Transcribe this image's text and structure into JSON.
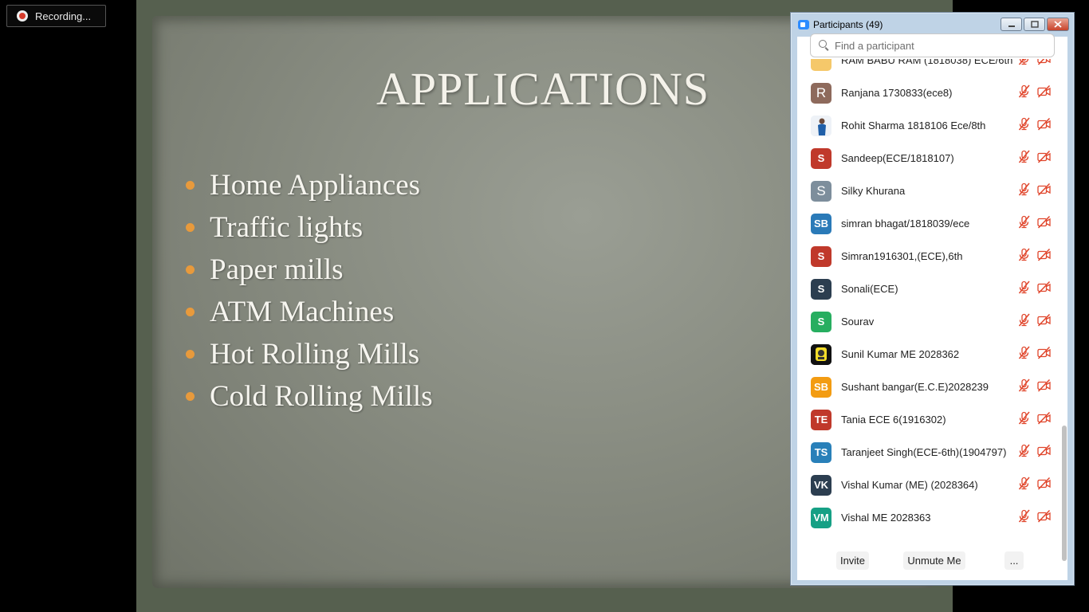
{
  "recording": {
    "label": "Recording..."
  },
  "slide": {
    "title": "APPLICATIONS",
    "bullets": [
      "Home Appliances",
      "Traffic lights",
      "Paper mills",
      "ATM Machines",
      "Hot Rolling Mills",
      "Cold Rolling Mills"
    ],
    "bullet_color": "#e89a3c"
  },
  "participants_window": {
    "title": "Participants (49)",
    "search_placeholder": "Find a participant",
    "participants": [
      {
        "name": "RAM BABU RAM (1818038) ECE/6th",
        "initials": "",
        "color": "#f5c86a",
        "avatar": "solid"
      },
      {
        "name": "Ranjana 1730833(ece8)",
        "initials": "R",
        "color": "#8e6a5c",
        "avatar": "letter"
      },
      {
        "name": "Rohit Sharma 1818106 Ece/8th",
        "initials": "",
        "color": "#e8eef5",
        "avatar": "photo-person"
      },
      {
        "name": "Sandeep(ECE/1818107)",
        "initials": "S",
        "color": "#c0392b",
        "avatar": "initials"
      },
      {
        "name": "Silky Khurana",
        "initials": "S",
        "color": "#7d8e9c",
        "avatar": "letter"
      },
      {
        "name": "simran bhagat/1818039/ece",
        "initials": "SB",
        "color": "#2a7ab8",
        "avatar": "initials"
      },
      {
        "name": "Simran1916301,(ECE),6th",
        "initials": "S",
        "color": "#c0392b",
        "avatar": "initials"
      },
      {
        "name": "Sonali(ECE)",
        "initials": "S",
        "color": "#2c3e50",
        "avatar": "initials"
      },
      {
        "name": "Sourav",
        "initials": "S",
        "color": "#27ae60",
        "avatar": "initials"
      },
      {
        "name": "Sunil Kumar ME 2028362",
        "initials": "",
        "color": "#111111",
        "avatar": "photo-yellow"
      },
      {
        "name": "Sushant bangar(E.C.E)2028239",
        "initials": "SB",
        "color": "#f39c12",
        "avatar": "initials"
      },
      {
        "name": "Tania ECE 6(1916302)",
        "initials": "TE",
        "color": "#c0392b",
        "avatar": "initials"
      },
      {
        "name": "Taranjeet Singh(ECE-6th)(1904797)",
        "initials": "TS",
        "color": "#2980b9",
        "avatar": "initials"
      },
      {
        "name": "Vishal Kumar (ME) (2028364)",
        "initials": "VK",
        "color": "#2c3e50",
        "avatar": "initials"
      },
      {
        "name": "Vishal ME 2028363",
        "initials": "VM",
        "color": "#16a085",
        "avatar": "initials"
      }
    ],
    "footer": {
      "invite": "Invite",
      "unmute": "Unmute Me",
      "more": "..."
    },
    "muted_color": "#e0452b"
  }
}
